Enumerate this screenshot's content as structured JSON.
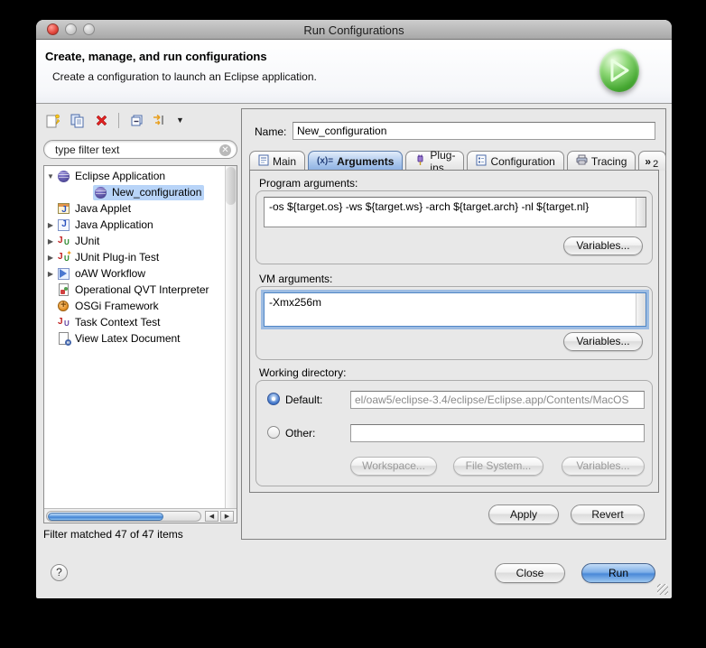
{
  "window": {
    "title": "Run Configurations"
  },
  "header": {
    "title": "Create, manage, and run configurations",
    "subtitle": "Create a configuration to launch an Eclipse application."
  },
  "toolbar": {
    "icons": [
      "new-configuration",
      "duplicate-configuration",
      "delete-configuration",
      "collapse-all",
      "filter-launch-configurations"
    ]
  },
  "filter": {
    "placeholder": "type filter text"
  },
  "tree": {
    "items": [
      {
        "label": "Eclipse Application",
        "icon": "eclipse-application-icon",
        "expander": "expanded",
        "level": 0,
        "selected": false
      },
      {
        "label": "New_configuration",
        "icon": "eclipse-application-icon",
        "expander": "none",
        "level": 1,
        "selected": true
      },
      {
        "label": "Java Applet",
        "icon": "java-applet-icon",
        "expander": "none",
        "level": 0,
        "selected": false
      },
      {
        "label": "Java Application",
        "icon": "java-application-icon",
        "expander": "collapsed",
        "level": 0,
        "selected": false
      },
      {
        "label": "JUnit",
        "icon": "junit-icon",
        "expander": "collapsed",
        "level": 0,
        "selected": false
      },
      {
        "label": "JUnit Plug-in Test",
        "icon": "junit-plugin-test-icon",
        "expander": "collapsed",
        "level": 0,
        "selected": false
      },
      {
        "label": "oAW Workflow",
        "icon": "oaw-workflow-icon",
        "expander": "collapsed",
        "level": 0,
        "selected": false
      },
      {
        "label": "Operational QVT Interpreter",
        "icon": "qvt-interpreter-icon",
        "expander": "none",
        "level": 0,
        "selected": false
      },
      {
        "label": "OSGi Framework",
        "icon": "osgi-framework-icon",
        "expander": "none",
        "level": 0,
        "selected": false
      },
      {
        "label": "Task Context Test",
        "icon": "task-context-test-icon",
        "expander": "none",
        "level": 0,
        "selected": false
      },
      {
        "label": "View Latex Document",
        "icon": "view-latex-document-icon",
        "expander": "none",
        "level": 0,
        "selected": false
      }
    ],
    "status": "Filter matched 47 of 47 items"
  },
  "form": {
    "name_label": "Name:",
    "name_value": "New_configuration"
  },
  "tabs": {
    "items": [
      {
        "label": "Main",
        "selected": false
      },
      {
        "label": "Arguments",
        "selected": true
      },
      {
        "label": "Plug-ins",
        "selected": false
      },
      {
        "label": "Configuration",
        "selected": false
      },
      {
        "label": "Tracing",
        "selected": false
      }
    ],
    "arguments_glyph": "(x)=",
    "overflow_chevron": "»",
    "overflow_count": "2"
  },
  "arguments_tab": {
    "program": {
      "label": "Program arguments:",
      "value": "-os ${target.os} -ws ${target.ws} -arch ${target.arch} -nl ${target.nl}",
      "variables_button": "Variables..."
    },
    "vm": {
      "label": "VM arguments:",
      "value": "-Xmx256m",
      "variables_button": "Variables..."
    },
    "working_directory": {
      "label": "Working directory:",
      "default_label": "Default:",
      "default_value": "el/oaw5/eclipse-3.4/eclipse/Eclipse.app/Contents/MacOS",
      "other_label": "Other:",
      "other_value": "",
      "workspace_button": "Workspace...",
      "filesystem_button": "File System...",
      "variables_button": "Variables..."
    }
  },
  "actions": {
    "apply": "Apply",
    "revert": "Revert",
    "close": "Close",
    "run": "Run",
    "help": "?"
  },
  "colors": {
    "accent": "#3b7fd4",
    "selection": "#b8d4f8",
    "tab_selected": "#aac6ec",
    "run_green": "#46a832"
  }
}
